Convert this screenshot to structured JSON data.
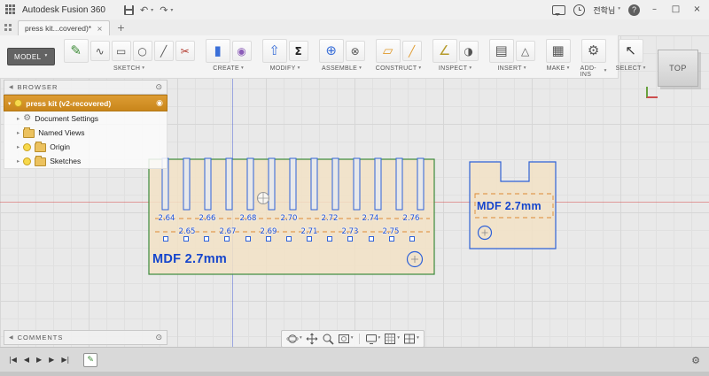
{
  "ui": {
    "caret": "▾",
    "gear_glyph": "⚙",
    "radio_glyph": "◉",
    "settings_glyph": "⊙",
    "expander_collapsed": "▸",
    "expander_expanded": "▾",
    "collapse_glyph": "◀"
  },
  "titlebar": {
    "app_title": "Autodesk Fusion 360",
    "undo_glyph": "↶",
    "redo_glyph": "↷",
    "user_name": "전학님",
    "help_label": "?",
    "minimize_glyph": "–",
    "maximize_glyph": "□",
    "close_glyph": "×"
  },
  "tabbar": {
    "tab_label": "press kit...covered)*",
    "tab_close_glyph": "×",
    "new_tab_glyph": "+"
  },
  "toolbar": {
    "model_label": "MODEL",
    "groups": [
      {
        "label": "SKETCH"
      },
      {
        "label": "CREATE"
      },
      {
        "label": "MODIFY"
      },
      {
        "label": "ASSEMBLE"
      },
      {
        "label": "CONSTRUCT"
      },
      {
        "label": "INSPECT"
      },
      {
        "label": "INSERT"
      },
      {
        "label": "MAKE"
      },
      {
        "label": "ADD-INS"
      },
      {
        "label": "SELECT"
      }
    ]
  },
  "toolbar_icons": {
    "pencil": "✎",
    "spline": "∿",
    "slot": "▭",
    "circle": "○",
    "line": "╱",
    "trim": "✂",
    "extrude": "▮",
    "form": "◉",
    "press_pull": "⇧",
    "parameters": "Σ",
    "joint": "⊕",
    "component": "⊗",
    "plane": "▱",
    "axis": "╱",
    "measure": "∠",
    "section": "◑",
    "image": "▤",
    "mesh": "△",
    "print": "▦",
    "cam": "▣",
    "scripts": "⚙",
    "addins_menu": "≡",
    "select": "↖"
  },
  "browser": {
    "header": "BROWSER",
    "root_label": "press kit (v2-recovered)",
    "items": [
      {
        "label": "Document Settings"
      },
      {
        "label": "Named Views"
      },
      {
        "label": "Origin"
      },
      {
        "label": "Sketches"
      }
    ]
  },
  "comments": {
    "header": "COMMENTS"
  },
  "viewcube": {
    "top_label": "TOP"
  },
  "canvas": {
    "left_part": {
      "material_label": "MDF 2.7mm",
      "dims": [
        "2.64",
        "2.65",
        "2.66",
        "2.67",
        "2.68",
        "2.69",
        "2.70",
        "2.71",
        "2.72",
        "2.73",
        "2.74",
        "2.75",
        "2.76"
      ]
    },
    "right_part": {
      "material_label": "MDF 2.7mm"
    }
  },
  "timeline": {
    "controls": [
      {
        "glyph": "|◀"
      },
      {
        "glyph": "◀"
      },
      {
        "glyph": "▶"
      },
      {
        "glyph": "▶"
      },
      {
        "glyph": "▶|"
      }
    ]
  }
}
